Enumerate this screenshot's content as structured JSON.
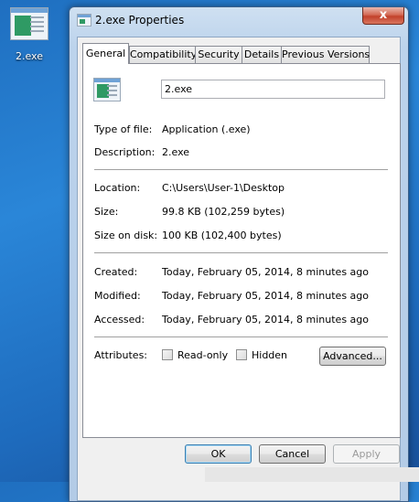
{
  "desktop": {
    "icon_label": "2.exe"
  },
  "window": {
    "title": "2.exe Properties",
    "close_glyph": "x"
  },
  "tabs": [
    {
      "label": "General",
      "active": true
    },
    {
      "label": "Compatibility"
    },
    {
      "label": "Security"
    },
    {
      "label": "Details"
    },
    {
      "label": "Previous Versions"
    }
  ],
  "general": {
    "file_name": "2.exe",
    "type_label": "Type of file:",
    "type_value": "Application (.exe)",
    "description_label": "Description:",
    "description_value": "2.exe",
    "location_label": "Location:",
    "location_value": "C:\\Users\\User-1\\Desktop",
    "size_label": "Size:",
    "size_value": "99.8 KB (102,259 bytes)",
    "size_on_disk_label": "Size on disk:",
    "size_on_disk_value": "100 KB (102,400 bytes)",
    "created_label": "Created:",
    "created_value": "Today, February 05, 2014, 8 minutes ago",
    "modified_label": "Modified:",
    "modified_value": "Today, February 05, 2014, 8 minutes ago",
    "accessed_label": "Accessed:",
    "accessed_value": "Today, February 05, 2014, 8 minutes ago",
    "attributes_label": "Attributes:",
    "readonly_label": "Read-only",
    "readonly_checked": false,
    "hidden_label": "Hidden",
    "hidden_checked": false,
    "advanced_label": "Advanced..."
  },
  "buttons": {
    "ok": "OK",
    "cancel": "Cancel",
    "apply": "Apply"
  },
  "colors": {
    "desktop": "#1f6fc0",
    "window_frame": "#bcd3ec",
    "close_button": "#c2412b"
  }
}
